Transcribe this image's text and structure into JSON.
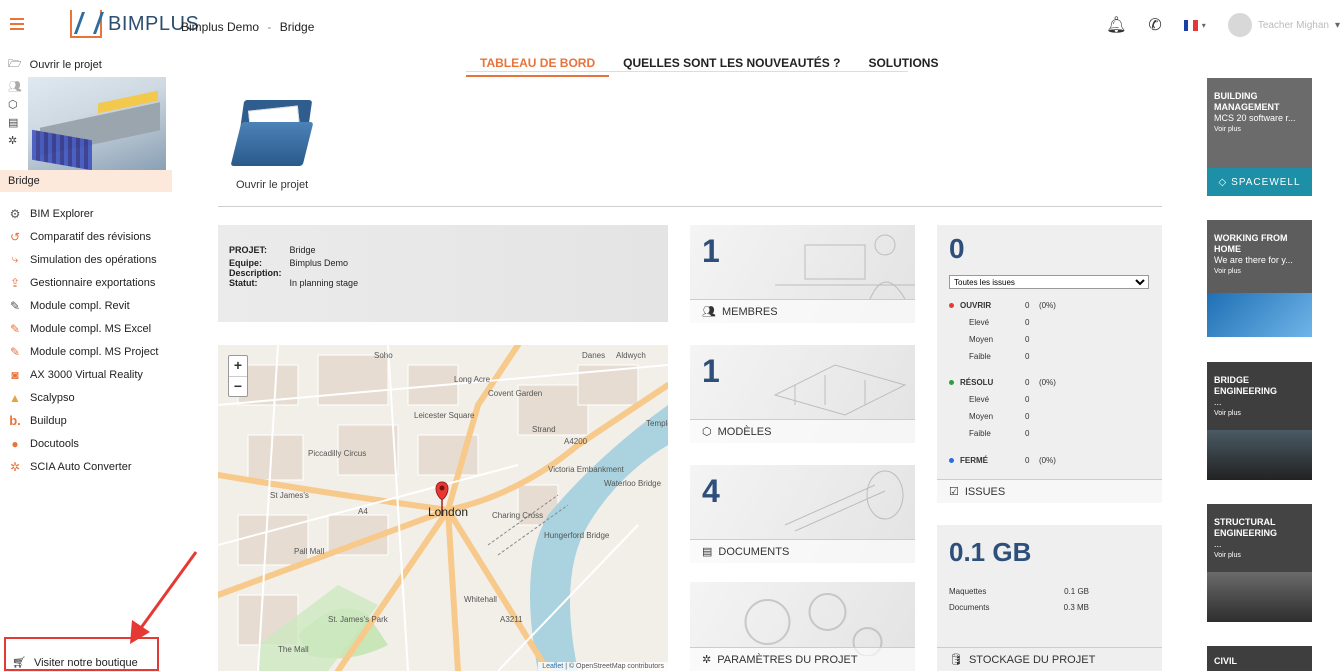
{
  "header": {
    "logo_text": "BIMPLUS",
    "breadcrumb_project": "Bimplus Demo",
    "breadcrumb_separator": "-",
    "breadcrumb_model": "Bridge",
    "user_name": "Teacher Mighan"
  },
  "sidebar": {
    "open_project": "Ouvrir le projet",
    "project_name": "Bridge",
    "items": [
      {
        "label": "BIM Explorer",
        "icon": "bim-explorer-icon",
        "glyph": "⚙",
        "color": "#555555"
      },
      {
        "label": "Comparatif des révisions",
        "icon": "revision-compare-icon",
        "glyph": "↺",
        "color": "#e8743b"
      },
      {
        "label": "Simulation des opérations",
        "icon": "simulation-icon",
        "glyph": "⤷",
        "color": "#e8743b"
      },
      {
        "label": "Gestionnaire exportations",
        "icon": "export-manager-icon",
        "glyph": "⇪",
        "color": "#e8743b"
      },
      {
        "label": "Module compl. Revit",
        "icon": "revit-addon-icon",
        "glyph": "✎",
        "color": "#555555"
      },
      {
        "label": "Module compl. MS Excel",
        "icon": "excel-addon-icon",
        "glyph": "✎",
        "color": "#e8743b"
      },
      {
        "label": "Module compl. MS Project",
        "icon": "project-addon-icon",
        "glyph": "✎",
        "color": "#e8743b"
      },
      {
        "label": "AX 3000 Virtual Reality",
        "icon": "vr-icon",
        "glyph": "◙",
        "color": "#e8743b"
      },
      {
        "label": "Scalypso",
        "icon": "scalypso-icon",
        "glyph": "▲",
        "color": "#e8a33b"
      },
      {
        "label": "Buildup",
        "icon": "buildup-icon",
        "glyph": "b.",
        "color": "#e8743b"
      },
      {
        "label": "Docutools",
        "icon": "docutools-icon",
        "glyph": "●",
        "color": "#e8743b"
      },
      {
        "label": "SCIA Auto Converter",
        "icon": "scia-icon",
        "glyph": "✲",
        "color": "#e8743b"
      }
    ],
    "shop_label": "Visiter notre boutique"
  },
  "tabs": [
    {
      "label": "TABLEAU DE BORD",
      "active": true
    },
    {
      "label": "QUELLES SONT LES NOUVEAUTÉS ?",
      "active": false
    },
    {
      "label": "SOLUTIONS",
      "active": false
    }
  ],
  "open_project_tile": {
    "label": "Ouvrir le projet"
  },
  "project_info": {
    "project_key": "PROJET:",
    "project_val": "Bridge",
    "team_key": "Equipe:",
    "team_val": "Bimplus Demo",
    "desc_key": "Description:",
    "desc_val": "",
    "status_key": "Statut:",
    "status_val": "In planning stage"
  },
  "map": {
    "labels": [
      "Soho",
      "Covent Garden",
      "Leicester Square",
      "Piccadilly Circus",
      "St James's",
      "Charing Cross",
      "Hungerford Bridge",
      "Waterloo Bridge",
      "St. James's Park",
      "London",
      "A4",
      "A4200",
      "A3211",
      "Strand",
      "The Mall",
      "Pall Mall",
      "Whitehall",
      "Danes",
      "Aldwych",
      "Temple",
      "Long Acre",
      "Victoria Embankment"
    ],
    "center_label": "London",
    "attribution_leaflet": "Leaflet",
    "attribution_rest": " | © OpenStreetMap contributors"
  },
  "tiles": {
    "members": {
      "count": "1",
      "label": "MEMBRES",
      "icon": "members-icon"
    },
    "models": {
      "count": "1",
      "label": "MODÈLES",
      "icon": "cube-icon"
    },
    "documents": {
      "count": "4",
      "label": "DOCUMENTS",
      "icon": "document-icon"
    },
    "settings": {
      "label": "PARAMÈTRES DU PROJET",
      "icon": "gear-icon"
    }
  },
  "issues": {
    "count": "0",
    "filter": "Toutes les issues",
    "open_label": "OUVRIR",
    "open_val": "0",
    "open_pct": "(0%)",
    "resolved_label": "RÉSOLU",
    "resolved_val": "0",
    "resolved_pct": "(0%)",
    "closed_label": "FERMÉ",
    "closed_val": "0",
    "closed_pct": "(0%)",
    "high": "Elevé",
    "medium": "Moyen",
    "low": "Faible",
    "zero": "0",
    "footer": "ISSUES",
    "colors": {
      "open": "#e53935",
      "resolved": "#2e9e3e",
      "closed": "#2b6ce0"
    }
  },
  "storage": {
    "total": "0.1 GB",
    "models_label": "Maquettes",
    "models_val": "0.1 GB",
    "docs_label": "Documents",
    "docs_val": "0.3 MB",
    "footer": "STOCKAGE DU PROJET"
  },
  "ads": [
    {
      "title": "BUILDING MANAGEMENT",
      "subtitle": "MCS 20 software r...",
      "more": "Voir plus",
      "brand": "SPACEWELL"
    },
    {
      "title": "WORKING FROM HOME",
      "subtitle": "We are there for y...",
      "more": "Voir plus"
    },
    {
      "title": "BRIDGE ENGINEERING",
      "subtitle": "...",
      "more": "Voir plus"
    },
    {
      "title": "STRUCTURAL ENGINEERING",
      "subtitle": "...",
      "more": "Voir plus"
    },
    {
      "title": "CIVIL"
    }
  ],
  "colors": {
    "accent": "#e8743b",
    "brand_blue": "#2e4f7a",
    "annotation_red": "#e53935"
  }
}
